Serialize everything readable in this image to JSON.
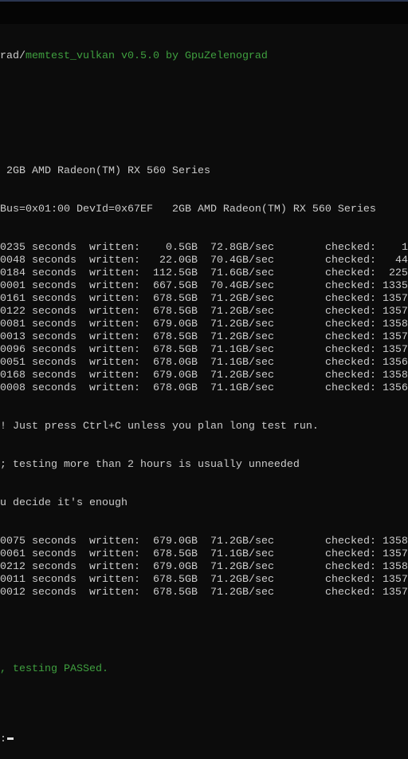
{
  "header": {
    "path_prefix": "rad/",
    "title": "memtest_vulkan v0.5.0 by GpuZelenograd"
  },
  "device_lines": [
    " 2GB AMD Radeon(TM) RX 560 Series",
    "Bus=0x01:00 DevId=0x67EF   2GB AMD Radeon(TM) RX 560 Series"
  ],
  "labels": {
    "seconds": "seconds",
    "written": "written:",
    "checked": "checked:"
  },
  "rows_before": [
    {
      "seconds": "0235",
      "written": "0.5GB",
      "rate": "72.8GB/sec",
      "checked": "1"
    },
    {
      "seconds": "0048",
      "written": "22.0GB",
      "rate": "70.4GB/sec",
      "checked": "44"
    },
    {
      "seconds": "0184",
      "written": "112.5GB",
      "rate": "71.6GB/sec",
      "checked": "225"
    },
    {
      "seconds": "0001",
      "written": "667.5GB",
      "rate": "70.4GB/sec",
      "checked": "1335"
    },
    {
      "seconds": "0161",
      "written": "678.5GB",
      "rate": "71.2GB/sec",
      "checked": "1357"
    },
    {
      "seconds": "0122",
      "written": "678.5GB",
      "rate": "71.2GB/sec",
      "checked": "1357"
    },
    {
      "seconds": "0081",
      "written": "679.0GB",
      "rate": "71.2GB/sec",
      "checked": "1358"
    },
    {
      "seconds": "0013",
      "written": "678.5GB",
      "rate": "71.2GB/sec",
      "checked": "1357"
    },
    {
      "seconds": "0096",
      "written": "678.5GB",
      "rate": "71.1GB/sec",
      "checked": "1357"
    },
    {
      "seconds": "0051",
      "written": "678.0GB",
      "rate": "71.1GB/sec",
      "checked": "1356"
    },
    {
      "seconds": "0168",
      "written": "679.0GB",
      "rate": "71.2GB/sec",
      "checked": "1358"
    },
    {
      "seconds": "0008",
      "written": "678.0GB",
      "rate": "71.1GB/sec",
      "checked": "1356"
    }
  ],
  "messages": [
    "! Just press Ctrl+C unless you plan long test run.",
    "; testing more than 2 hours is usually unneeded",
    "u decide it's enough"
  ],
  "rows_after": [
    {
      "seconds": "0075",
      "written": "679.0GB",
      "rate": "71.2GB/sec",
      "checked": "1358"
    },
    {
      "seconds": "0061",
      "written": "678.5GB",
      "rate": "71.1GB/sec",
      "checked": "1357"
    },
    {
      "seconds": "0212",
      "written": "679.0GB",
      "rate": "71.2GB/sec",
      "checked": "1358"
    },
    {
      "seconds": "0011",
      "written": "678.5GB",
      "rate": "71.2GB/sec",
      "checked": "1357"
    },
    {
      "seconds": "0012",
      "written": "678.5GB",
      "rate": "71.2GB/sec",
      "checked": "1357"
    }
  ],
  "result": ", testing PASSed.",
  "prompt": ":",
  "colors": {
    "text": "#cccccc",
    "green": "#3fa03f",
    "background": "#0c0c0c"
  }
}
